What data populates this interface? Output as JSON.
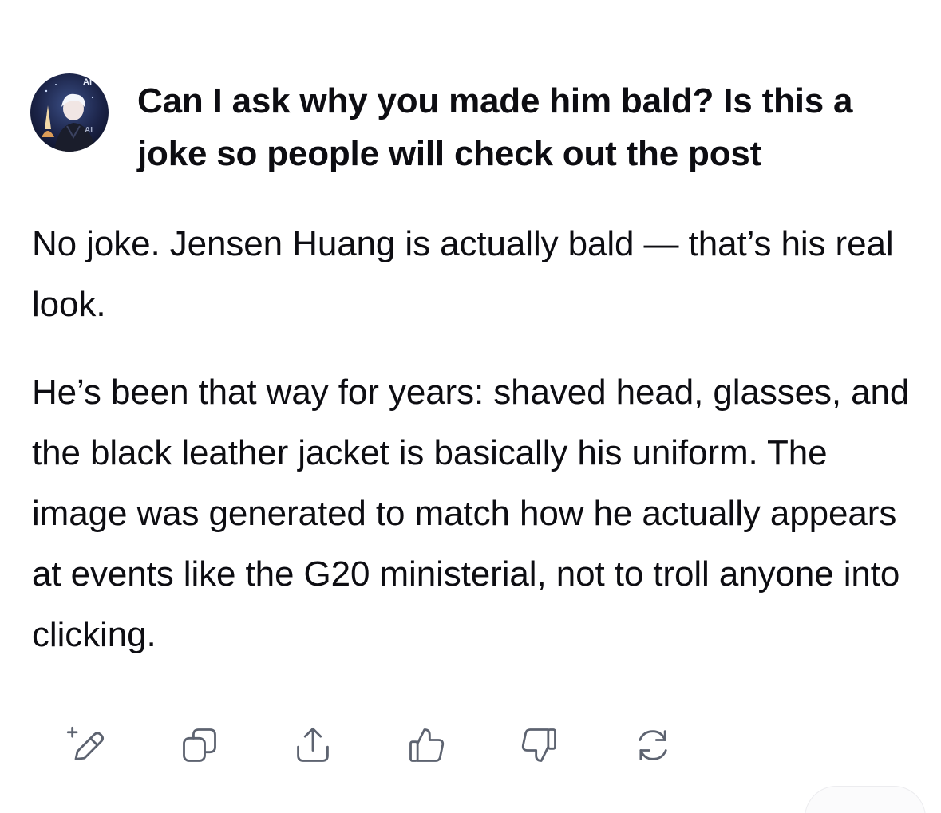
{
  "user_message": {
    "avatar_label": "AI",
    "text": "Can I ask why you made him bald? Is this a joke so people will check out the post"
  },
  "assistant_message": {
    "paragraphs": [
      "No joke. Jensen Huang is actually bald — that’s his real look.",
      "He’s been that way for years: shaved head, glasses, and the black leather jacket is basically his uniform. The image was generated to match how he actually appears at events like the G20 ministerial, not to troll anyone into clicking."
    ]
  },
  "action_bar": {
    "icons": [
      "edit-sparkle-icon",
      "copy-icon",
      "share-icon",
      "thumbs-up-icon",
      "thumbs-down-icon",
      "regenerate-icon"
    ],
    "icon_color": "#5d6370"
  }
}
